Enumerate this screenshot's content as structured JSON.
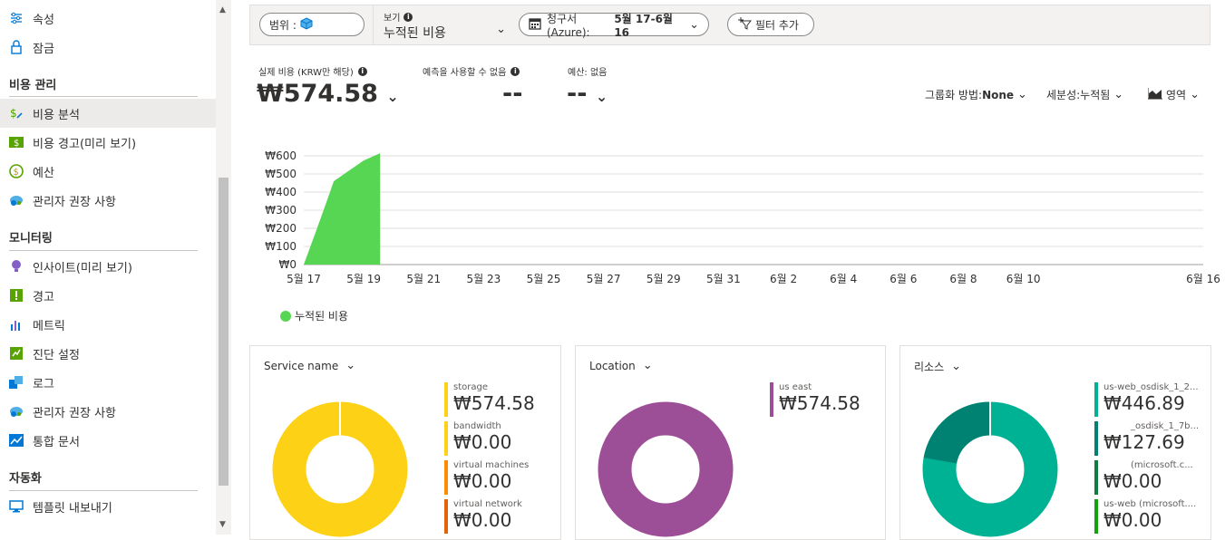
{
  "sidebar": {
    "items_top": [
      {
        "label": "속성",
        "icon": "properties-icon"
      },
      {
        "label": "잠금",
        "icon": "lock-icon"
      }
    ],
    "section_cost": "비용 관리",
    "items_cost": [
      {
        "label": "비용 분석",
        "icon": "cost-analysis-icon"
      },
      {
        "label": "비용 경고(미리 보기)",
        "icon": "cost-alert-icon"
      },
      {
        "label": "예산",
        "icon": "budget-icon"
      },
      {
        "label": "관리자 권장 사항",
        "icon": "advisor-icon"
      }
    ],
    "section_monitor": "모니터링",
    "items_monitor": [
      {
        "label": "인사이트(미리 보기)",
        "icon": "insights-icon"
      },
      {
        "label": "경고",
        "icon": "alert-icon"
      },
      {
        "label": "메트릭",
        "icon": "metrics-icon"
      },
      {
        "label": "진단 설정",
        "icon": "diagnostics-icon"
      },
      {
        "label": "로그",
        "icon": "logs-icon"
      },
      {
        "label": "관리자 권장 사항",
        "icon": "advisor-icon"
      },
      {
        "label": "통합 문서",
        "icon": "workbooks-icon"
      }
    ],
    "section_automation": "자동화",
    "items_automation": [
      {
        "label": "템플릿 내보내기",
        "icon": "export-template-icon"
      }
    ]
  },
  "toolbar": {
    "scope_label": "범위 :",
    "view_caption": "보기",
    "view_value": "누적된 비용",
    "invoice_prefix": "청구서(Azure): ",
    "invoice_range": "5월 17-6월 16",
    "add_filter": "필터 추가"
  },
  "kpis": {
    "actual_label": "실제 비용 (KRW만 해당)",
    "actual_value": "₩574.58",
    "forecast_label": "예측을 사용할 수 없음",
    "forecast_value": "--",
    "budget_label": "예산: 없음",
    "budget_value": "--"
  },
  "controls": {
    "group_by_label": "그룹화 방법: ",
    "group_by_value": "None",
    "granularity_label": "세분성: ",
    "granularity_value": "누적됨",
    "chart_type": "영역"
  },
  "colors": {
    "area": "#57d654",
    "storage": "#fcd116",
    "bandwidth": "#fcd116",
    "vm": "#ff8c00",
    "vnet": "#e3630a",
    "location": "#9c4f96",
    "res1": "#00b294",
    "res2": "#008272",
    "res3": "#107c41",
    "res4": "#13a10e"
  },
  "chart_data": {
    "type": "area",
    "x": [
      "5월 17",
      "5월 18",
      "5월 19"
    ],
    "y": [
      0,
      460,
      574.58
    ],
    "series": [
      {
        "name": "누적된 비용",
        "values": [
          0,
          460,
          574.58
        ]
      }
    ],
    "x_ticks": [
      "5월 17",
      "5월 19",
      "5월 21",
      "5월 23",
      "5월 25",
      "5월 27",
      "5월 29",
      "5월 31",
      "6월 2",
      "6월 4",
      "6월 6",
      "6월 8",
      "6월 10",
      "6월 16"
    ],
    "y_ticks": [
      "₩0",
      "₩100",
      "₩200",
      "₩300",
      "₩400",
      "₩500",
      "₩600"
    ],
    "ylim": [
      0,
      600
    ],
    "legend_placement": "bottom-left",
    "legend": "누적된 비용"
  },
  "cards": [
    {
      "title": "Service name",
      "items": [
        {
          "name": "storage",
          "amount": "₩574.58"
        },
        {
          "name": "bandwidth",
          "amount": "₩0.00"
        },
        {
          "name": "virtual machines",
          "amount": "₩0.00"
        },
        {
          "name": "virtual network",
          "amount": "₩0.00"
        }
      ]
    },
    {
      "title": "Location",
      "items": [
        {
          "name": "us east",
          "amount": "₩574.58"
        }
      ]
    },
    {
      "title": "리소스",
      "items": [
        {
          "name": "us-web_osdisk_1_2...",
          "amount": "₩446.89"
        },
        {
          "name": "_osdisk_1_7b...",
          "amount": "₩127.69"
        },
        {
          "name": "(microsoft.c...",
          "amount": "₩0.00"
        },
        {
          "name": "us-web (microsoft....",
          "amount": "₩0.00"
        }
      ],
      "donut_values": [
        446.89,
        127.69
      ]
    }
  ]
}
